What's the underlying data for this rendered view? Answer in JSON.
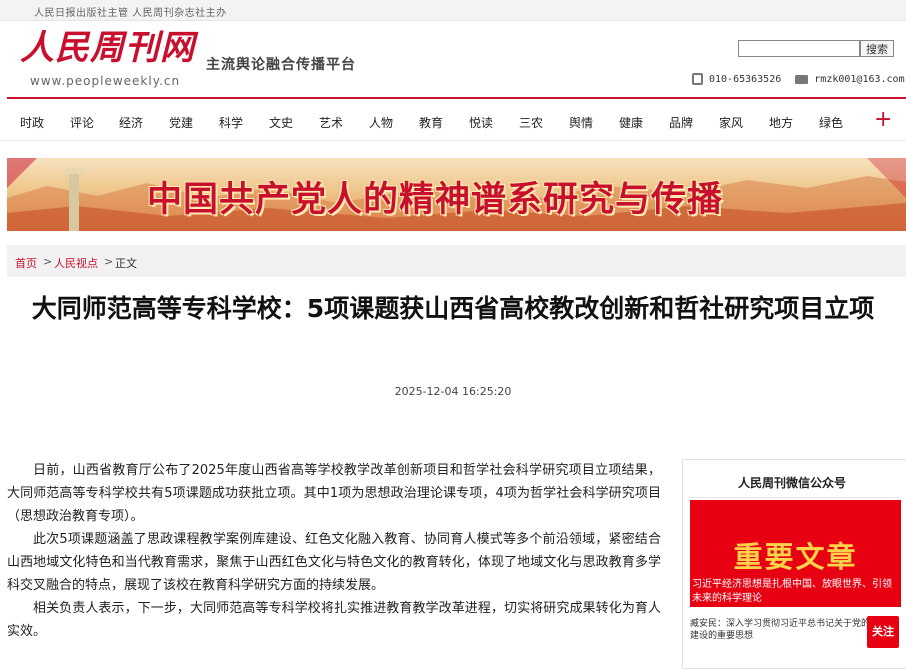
{
  "topbar": {
    "text": "人民日报出版社主管  人民周刊杂志社主办"
  },
  "header": {
    "logo_text": "人民周刊网",
    "logo_url": "www.peopleweekly.cn",
    "slogan": "主流舆论融合传播平台",
    "search_button": "搜索",
    "search_value": "",
    "phone": "010-65363526",
    "email": "rmzk001@163.com"
  },
  "nav": {
    "items": [
      "时政",
      "评论",
      "经济",
      "党建",
      "科学",
      "文史",
      "艺术",
      "人物",
      "教育",
      "悦读",
      "三农",
      "舆情",
      "健康",
      "品牌",
      "家风",
      "地方",
      "绿色"
    ],
    "more_icon": "+"
  },
  "banner": {
    "text": "中国共产党人的精神谱系研究与传播"
  },
  "breadcrumb": {
    "home": "首页",
    "section": "人民视点",
    "current": "正文",
    "separator": ">"
  },
  "article": {
    "title": "大同师范高等专科学校：5项课题获山西省高校教改创新和哲社研究项目立项",
    "date": "2025-12-04 16:25:20",
    "paragraphs": [
      "日前，山西省教育厅公布了2025年度山西省高等学校教学改革创新项目和哲学社会科学研究项目立项结果，大同师范高等专科学校共有5项课题成功获批立项。其中1项为思想政治理论课专项，4项为哲学社会科学研究项目（思想政治教育专项）。",
      "此次5项课题涵盖了思政课程教学案例库建设、红色文化融入教育、协同育人模式等多个前沿领域，紧密结合山西地域文化特色和当代教育需求，聚焦于山西红色文化与特色文化的教育转化，体现了地域文化与思政教育多学科交叉融合的特点，展现了该校在教育科学研究方面的持续发展。",
      "相关负责人表示，下一步，大同师范高等专科学校将扎实推进教育教学改革进程，切实将研究成果转化为育人实效。"
    ]
  },
  "sidebar": {
    "title": "人民周刊微信公众号",
    "promo_heading": "重要文章",
    "promo_text": "习近平经济思想是扎根中国、放眼世界、引领未来的科学理论",
    "item_text": "臧安民：深入学习贯彻习近平总书记关于党的建设的重要思想",
    "follow_label": "关注"
  },
  "colors": {
    "brand_red": "#c8102e",
    "promo_red": "#e60012",
    "promo_gold": "#ffd24a"
  }
}
